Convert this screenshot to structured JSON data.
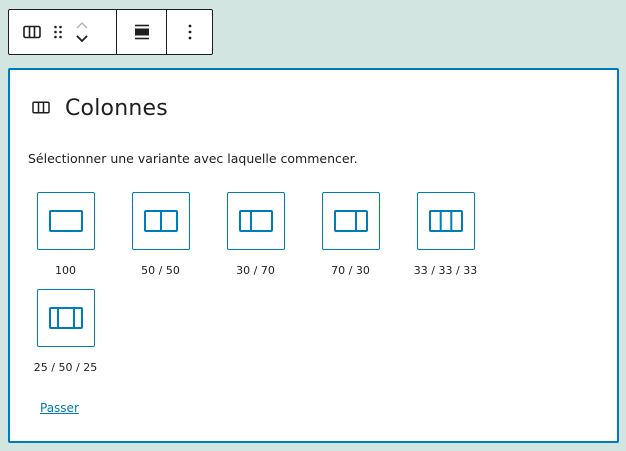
{
  "toolbar": {
    "items": [
      {
        "name": "columns-block-icon"
      },
      {
        "name": "drag-handle-icon"
      },
      {
        "name": "move-up-icon"
      },
      {
        "name": "move-down-icon"
      },
      {
        "name": "align-icon"
      },
      {
        "name": "more-options-icon"
      }
    ]
  },
  "placeholder": {
    "icon": "columns-icon",
    "title": "Colonnes",
    "instructions": "Sélectionner une variante avec laquelle commencer.",
    "variations": [
      {
        "label": "100",
        "icon": "columns-100-icon"
      },
      {
        "label": "50 / 50",
        "icon": "columns-50-50-icon"
      },
      {
        "label": "30 / 70",
        "icon": "columns-30-70-icon"
      },
      {
        "label": "70 / 30",
        "icon": "columns-70-30-icon"
      },
      {
        "label": "33 / 33 / 33",
        "icon": "columns-33-33-33-icon"
      },
      {
        "label": "25 / 50 / 25",
        "icon": "columns-25-50-25-icon"
      }
    ],
    "skip_label": "Passer"
  },
  "colors": {
    "accent": "#007cba",
    "background": "#d3e5e0",
    "text": "#1e1e1e"
  }
}
